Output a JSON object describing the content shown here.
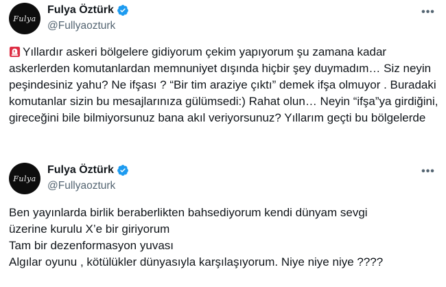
{
  "tweets": [
    {
      "author": {
        "display_name": "Fulya Öztürk",
        "handle": "@Fullyaozturk",
        "avatar_text": "Fulya",
        "verified_icon": "verified-badge-icon"
      },
      "more_icon": "more-options-icon",
      "emoji_icon": "rotating-light-icon",
      "text": "Yıllardır askeri bölgelere gidiyorum çekim yapıyorum şu zamana kadar askerlerden komutanlardan memnuniyet dışında hiçbir şey duymadım… Siz neyin peşindesiniz yahu? Ne ifşası ? “Bir tim araziye çıktı” demek ifşa olmuyor . Buradaki komutanlar sizin bu mesajlarınıza  gülümsedi:) Rahat olun… Neyin “ifşa”ya girdiğini, gireceğini bile bilmiyorsunuz bana akıl veriyorsunuz? Yıllarım geçti bu bölgelerde"
    },
    {
      "author": {
        "display_name": "Fulya Öztürk",
        "handle": "@Fullyaozturk",
        "avatar_text": "Fulya",
        "verified_icon": "verified-badge-icon"
      },
      "more_icon": "more-options-icon",
      "text": "Ben yayınlarda birlik beraberlikten bahsediyorum kendi dünyam sevgi\nüzerine kurulu X’e bir giriyorum\nTam bir dezenformasyon yuvası\nAlgılar oyunu , kötülükler dünyasıyla karşılaşıyorum. Niye niye niye ????"
    }
  ],
  "colors": {
    "text": "#0f1419",
    "secondary": "#536471",
    "verified": "#1d9bf0",
    "background": "#ffffff"
  }
}
